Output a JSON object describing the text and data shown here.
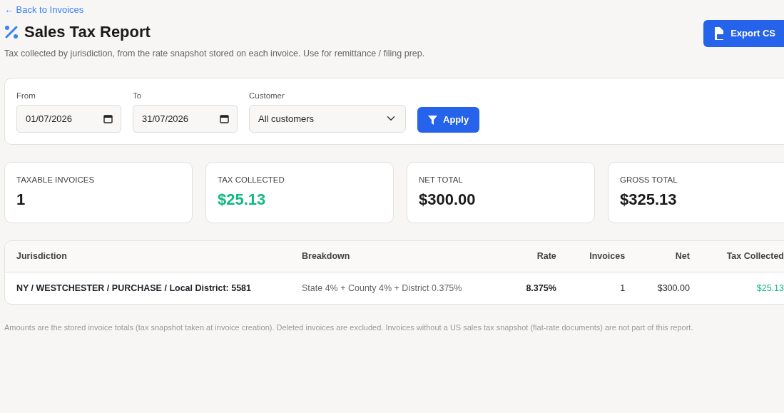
{
  "back_link": "← Back to Invoices",
  "page": {
    "title": "Sales Tax Report",
    "subtitle": "Tax collected by jurisdiction, from the rate snapshot stored on each invoice. Use for remittance / filing prep."
  },
  "export_button": "Export CS",
  "filters": [
    {
      "kind": "date",
      "label": "From",
      "value": "01/07/2026"
    },
    {
      "kind": "date",
      "label": "To",
      "value": "31/07/2026"
    },
    {
      "kind": "select",
      "label": "Customer",
      "value": "All customers"
    }
  ],
  "apply_button": "Apply",
  "stats": [
    {
      "label": "TAXABLE INVOICES",
      "value": "1",
      "kind": "plain"
    },
    {
      "label": "TAX COLLECTED",
      "value": "$25.13",
      "kind": "positive"
    },
    {
      "label": "NET TOTAL",
      "value": "$300.00",
      "kind": "plain"
    },
    {
      "label": "GROSS TOTAL",
      "value": "$325.13",
      "kind": "plain"
    }
  ],
  "table": {
    "columns": [
      "Jurisdiction",
      "Breakdown",
      "Rate",
      "Invoices",
      "Net",
      "Tax Collected"
    ],
    "rows": [
      [
        "NY / WESTCHESTER / PURCHASE / Local District: 5581",
        "State 4% + County 4% + District 0.375%",
        "8.375%",
        "1",
        "$300.00",
        "$25.13"
      ]
    ]
  },
  "footnote": "Amounts are the stored invoice totals (tax snapshot taken at invoice creation). Deleted invoices are excluded. Invoices without a US sales tax snapshot (flat-rate documents) are not part of this report."
}
